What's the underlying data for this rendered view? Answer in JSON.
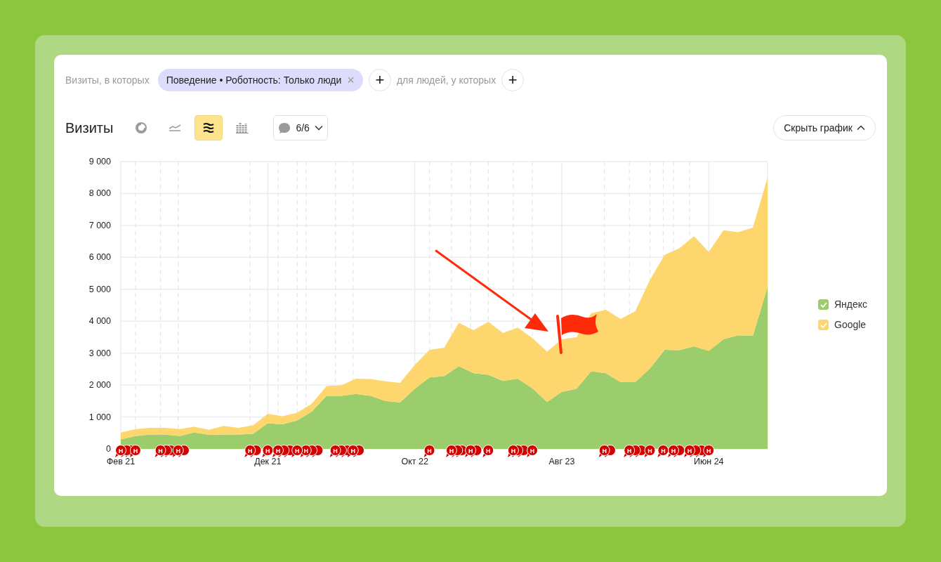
{
  "filters": {
    "prefix": "Визиты, в которых",
    "chip": {
      "label": "Поведение • Роботность: Только люди",
      "close": "×"
    },
    "add": "+",
    "middle": "для людей, у которых",
    "add_2": "+"
  },
  "toolbar": {
    "title": "Визиты",
    "chart_types": [
      {
        "kind": "pie",
        "selected": false
      },
      {
        "kind": "line",
        "selected": false
      },
      {
        "kind": "area",
        "selected": true
      },
      {
        "kind": "bar",
        "selected": false
      }
    ],
    "notes": {
      "label": "6/6"
    },
    "hide_button": {
      "label": "Скрыть график"
    }
  },
  "chart": {
    "chart_data": {
      "type": "area",
      "stacked": true,
      "categories": [
        "Фев 21",
        null,
        null,
        null,
        null,
        null,
        null,
        null,
        null,
        null,
        "Дек 21",
        null,
        null,
        null,
        null,
        null,
        null,
        null,
        null,
        null,
        "Окт 22",
        null,
        null,
        null,
        null,
        null,
        null,
        null,
        null,
        null,
        "Авг 23",
        null,
        null,
        null,
        null,
        null,
        null,
        null,
        null,
        null,
        "Июн 24",
        null,
        null,
        null,
        null
      ],
      "ylim": [
        0,
        9000
      ],
      "yticks": [
        {
          "value": 0,
          "label": "0"
        },
        {
          "value": 1000,
          "label": "1 000"
        },
        {
          "value": 2000,
          "label": "2 000"
        },
        {
          "value": 3000,
          "label": "3 000"
        },
        {
          "value": 4000,
          "label": "4 000"
        },
        {
          "value": 5000,
          "label": "5 000"
        },
        {
          "value": 6000,
          "label": "6 000"
        },
        {
          "value": 7000,
          "label": "7 000"
        },
        {
          "value": 8000,
          "label": "8 000"
        },
        {
          "value": 9000,
          "label": "9 000"
        }
      ],
      "series": [
        {
          "name": "Яндекс",
          "color": "#9bcd6d",
          "values": [
            300,
            400,
            450,
            450,
            400,
            520,
            440,
            450,
            450,
            470,
            800,
            770,
            890,
            1170,
            1660,
            1660,
            1720,
            1660,
            1500,
            1460,
            1880,
            2240,
            2280,
            2590,
            2370,
            2320,
            2130,
            2200,
            1900,
            1470,
            1790,
            1880,
            2430,
            2370,
            2090,
            2090,
            2520,
            3100,
            3090,
            3210,
            3070,
            3430,
            3560,
            3540,
            5070
          ]
        },
        {
          "name": "Google",
          "color": "#fdd76d",
          "values": [
            210,
            220,
            210,
            210,
            220,
            170,
            160,
            270,
            210,
            270,
            300,
            250,
            240,
            250,
            310,
            330,
            480,
            530,
            620,
            610,
            750,
            860,
            890,
            1360,
            1350,
            1660,
            1500,
            1600,
            1570,
            1580,
            1640,
            1620,
            1820,
            1990,
            1980,
            2220,
            2770,
            2980,
            3190,
            3450,
            3100,
            3420,
            3230,
            3390,
            3430
          ]
        }
      ],
      "grid": true
    },
    "note_markers": [
      {
        "text": "Н"
      },
      {
        "text": "Н"
      },
      {
        "text": "Н"
      },
      {
        "text": "Н"
      },
      {
        "text": "Н"
      },
      {
        "text": "Н"
      },
      {
        "text": "Н"
      },
      {
        "text": "Н"
      },
      {
        "text": "Н"
      },
      {
        "text": "Н"
      },
      {
        "text": "Н"
      },
      {
        "text": "Н"
      },
      {
        "text": "Н"
      },
      {
        "text": "Н"
      },
      {
        "text": "Н"
      },
      {
        "text": "Н"
      },
      {
        "text": "Н"
      },
      {
        "text": "Н"
      },
      {
        "text": "Н"
      },
      {
        "text": "Н"
      },
      {
        "text": "Н"
      },
      {
        "text": "Н"
      },
      {
        "text": "Н"
      },
      {
        "text": "Н"
      }
    ],
    "legend": [
      {
        "checked": true
      },
      {
        "checked": true
      }
    ]
  }
}
